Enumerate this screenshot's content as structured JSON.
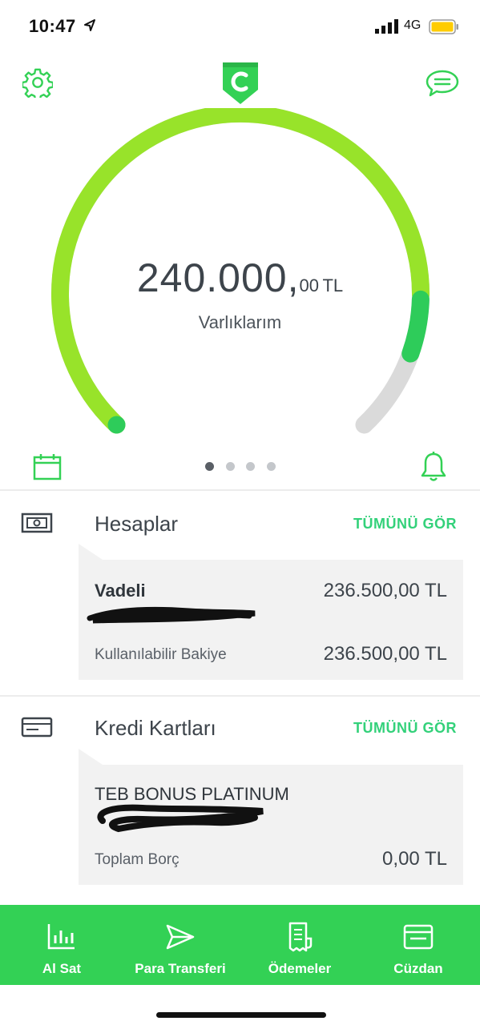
{
  "status_bar": {
    "time": "10:47",
    "network": "4G"
  },
  "colors": {
    "brand_green": "#33d155",
    "gauge_light": "#98e32a",
    "gauge_dark": "#2ecc5a",
    "card_bg": "#f2f2f2"
  },
  "header": {
    "settings_icon": "gear-icon",
    "logo_icon": "cepteteb-logo",
    "chat_icon": "chat-icon"
  },
  "gauge": {
    "amount_main": "240.000,",
    "amount_decimal": "00",
    "currency": "TL",
    "label": "Varlıklarım",
    "fill_fraction": 0.9
  },
  "pager": {
    "count": 4,
    "active_index": 0
  },
  "accounts": {
    "title": "Hesaplar",
    "see_all": "TÜMÜNÜ GÖR",
    "card": {
      "name": "Vadeli",
      "balance": "236.500,00 TL",
      "available_label": "Kullanılabilir Bakiye",
      "available_value": "236.500,00 TL"
    }
  },
  "credit_cards": {
    "title": "Kredi Kartları",
    "see_all": "TÜMÜNÜ GÖR",
    "card": {
      "name": "TEB BONUS PLATINUM",
      "debt_label": "Toplam Borç",
      "debt_value": "0,00 TL"
    }
  },
  "bottom_nav": [
    {
      "label": "Al Sat",
      "icon": "bar-chart-icon"
    },
    {
      "label": "Para Transferi",
      "icon": "send-icon"
    },
    {
      "label": "Ödemeler",
      "icon": "receipt-icon"
    },
    {
      "label": "Cüzdan",
      "icon": "wallet-icon"
    }
  ]
}
